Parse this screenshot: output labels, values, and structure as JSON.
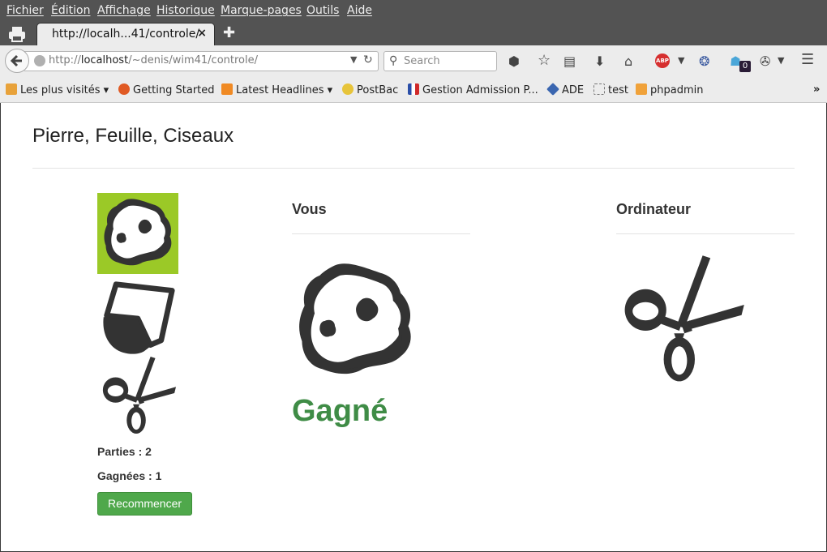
{
  "menubar": {
    "items": [
      "Fichier",
      "Édition",
      "Affichage",
      "Historique",
      "Marque-pages",
      "Outils",
      "Aide"
    ]
  },
  "tab": {
    "title": "http://localh...41/controle/",
    "close": "×"
  },
  "url": {
    "prefix": "http://",
    "host": "localhost",
    "path": "/~denis/wim41/controle/"
  },
  "search": {
    "placeholder": "Search"
  },
  "toolbar": {
    "adblock_label": "ABP",
    "notification_count": "0"
  },
  "bookmarks": [
    "Les plus visités ▾",
    "Getting Started",
    "Latest Headlines ▾",
    "PostBac",
    "Gestion Admission P...",
    "ADE",
    "test",
    "phpadmin"
  ],
  "page": {
    "title": "Pierre, Feuille, Ciseaux",
    "you_heading": "Vous",
    "computer_heading": "Ordinateur",
    "result": "Gagné",
    "games_played": "Parties : 2",
    "games_won": "Gagnées : 1",
    "restart_label": "Recommencer"
  },
  "choices": [
    {
      "name": "pierre",
      "icon": "rock-icon",
      "selected": true
    },
    {
      "name": "feuille",
      "icon": "paper-icon",
      "selected": false
    },
    {
      "name": "ciseaux",
      "icon": "scissors-icon",
      "selected": false
    }
  ],
  "player_choice": "rock-icon",
  "computer_choice": "scissors-icon",
  "colors": {
    "selected_bg": "#9bc927",
    "result": "#3f8c46",
    "button": "#4fa84b",
    "icon": "#333333"
  }
}
